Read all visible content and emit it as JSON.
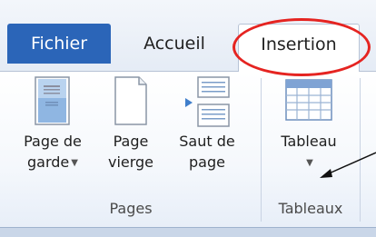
{
  "tabs": {
    "fichier": "Fichier",
    "accueil": "Accueil",
    "insertion": "Insertion"
  },
  "groups": {
    "pages": {
      "title": "Pages",
      "page_de_garde": [
        "Page de",
        "garde"
      ],
      "page_vierge": [
        "Page",
        "vierge"
      ],
      "saut_de_page": [
        "Saut de",
        "page"
      ]
    },
    "tableaux": {
      "title": "Tableaux",
      "tableau": "Tableau"
    }
  },
  "colors": {
    "file_tab": "#2b65b8",
    "highlight_ring": "#e52421"
  }
}
